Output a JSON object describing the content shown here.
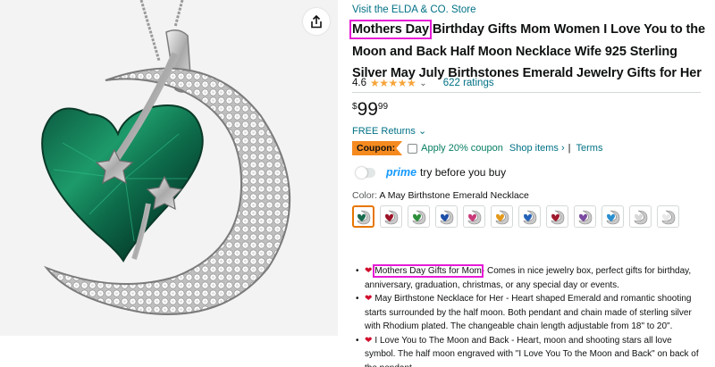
{
  "gallery": {
    "share_icon": "share-icon"
  },
  "product": {
    "store_link": "Visit the ELDA & CO. Store",
    "title_highlight": "Mothers Day",
    "title_rest": " Birthday Gifts Mom Women I Love You to the Moon and Back Half Moon Necklace Wife 925 Sterling Silver May July Birthstones Emerald Jewelry Gifts for Her",
    "rating_value": "4.6",
    "stars": "★★★★★",
    "rating_fraction": 0.92,
    "rating_chevron": "⌄",
    "rating_count": "622 ratings",
    "price_symbol": "$",
    "price_whole": "99",
    "price_fraction": "99",
    "returns": "FREE Returns ⌄",
    "coupon_label": "Coupon:",
    "coupon_apply": "Apply 20% coupon",
    "coupon_shop": "Shop items ›",
    "coupon_sep": "|",
    "coupon_terms": "Terms",
    "prime_logo": "prime",
    "prime_text": "try before you buy",
    "color_label": "Color:",
    "color_value": "A May Birthstone Emerald Necklace",
    "swatch_colors": [
      "#1a6b4e",
      "#9c1428",
      "#2d8f3a",
      "#1e4fa8",
      "#c93a7a",
      "#e39a1c",
      "#2563b8",
      "#a01a2e",
      "#7a4aa0",
      "#2a8fd0",
      "#d8d8d8",
      "#e8e8e8"
    ]
  },
  "bullets": [
    {
      "highlight": "Mothers Day Gifts for Mom",
      "text": "- Comes in nice jewelry box, perfect gifts for birthday, anniversary, graduation, christmas, or any special day or events."
    },
    {
      "highlight": "",
      "text": "May Birthstone Necklace for Her - Heart shaped Emerald and romantic shooting starts surrounded by the half moon. Both pendant and chain made of sterling silver with Rhodium plated. The changeable chain length adjustable from 18\" to 20\"."
    },
    {
      "highlight": "",
      "text": "I Love You to The Moon and Back - Heart, moon and shooting stars all love symbol. The half moon engraved with \"I Love You To the Moon and Back\" on back of the pendant."
    }
  ],
  "colors": {
    "link": "#007185",
    "highlight_box": "#e61bd6",
    "coupon": "#f58a1f",
    "prime": "#1399ff",
    "star": "#f7a43a",
    "heart": "#d00c2c"
  }
}
